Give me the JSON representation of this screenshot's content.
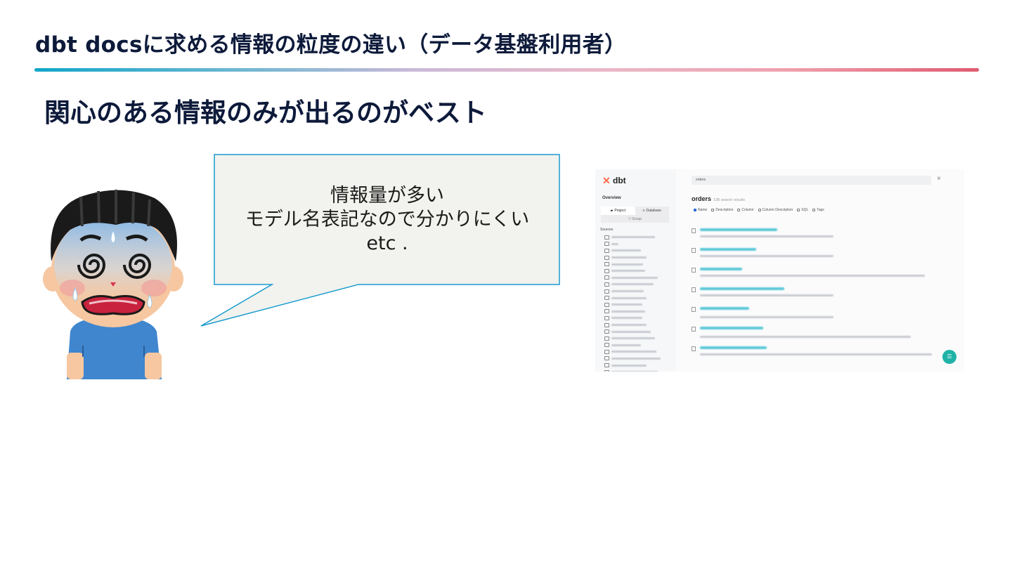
{
  "slide": {
    "title": "dbt docsに求める情報の粒度の違い（データ基盤利用者）",
    "subtitle": "関心のある情報のみが出るのがベスト"
  },
  "bubble": {
    "lines": [
      "情報量が多い",
      "モデル名表記なので分かりにくい",
      "etc ."
    ]
  },
  "screenshot": {
    "logo_text": "dbt",
    "sidebar": {
      "overview": "Overview",
      "tabs": [
        "Project",
        "Database"
      ],
      "group_button": "Group",
      "sources_label": "Sources"
    },
    "search": {
      "value": "orders",
      "close": "×"
    },
    "results": {
      "title": "orders",
      "count_text": "136 search results",
      "filters": [
        {
          "label": "Name",
          "checked": true
        },
        {
          "label": "Description",
          "checked": false
        },
        {
          "label": "Column",
          "checked": false
        },
        {
          "label": "Column Description",
          "checked": false
        },
        {
          "label": "SQL",
          "checked": false
        },
        {
          "label": "Tags",
          "checked": false
        }
      ]
    }
  },
  "colors": {
    "title": "#0d1a3a",
    "bubble_fill": "#f2f2ee",
    "bubble_stroke": "#1a9ccf",
    "accent_teal": "#1fb3a6"
  }
}
